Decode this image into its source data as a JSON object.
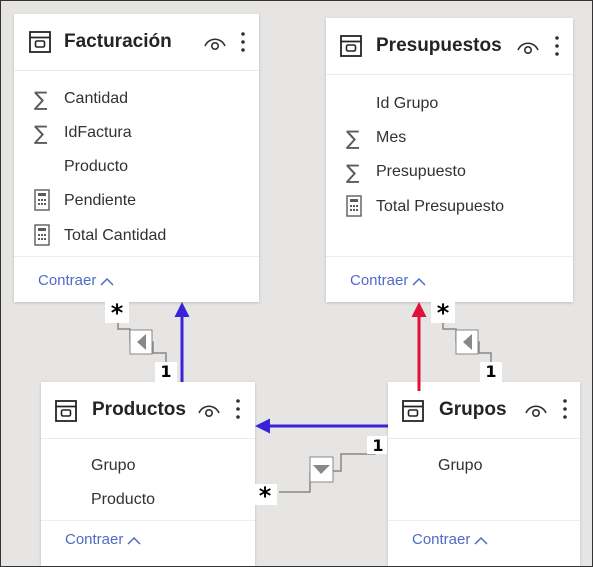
{
  "tables": [
    {
      "title": "Facturación",
      "fields": [
        {
          "icon": "sigma-icon",
          "label": "Cantidad"
        },
        {
          "icon": "sigma-icon",
          "label": "IdFactura"
        },
        {
          "icon": "none",
          "label": "Producto"
        },
        {
          "icon": "calculator-icon",
          "label": "Pendiente"
        },
        {
          "icon": "calculator-icon",
          "label": "Total Cantidad"
        }
      ],
      "collapse_label": "Contraer"
    },
    {
      "title": "Presupuestos",
      "fields": [
        {
          "icon": "none",
          "label": "Id Grupo"
        },
        {
          "icon": "sigma-icon",
          "label": "Mes"
        },
        {
          "icon": "sigma-icon",
          "label": "Presupuesto"
        },
        {
          "icon": "calculator-icon",
          "label": "Total Presupuesto"
        }
      ],
      "collapse_label": "Contraer"
    },
    {
      "title": "Productos",
      "fields": [
        {
          "icon": "none",
          "label": "Grupo"
        },
        {
          "icon": "none",
          "label": "Producto"
        }
      ],
      "collapse_label": "Contraer"
    },
    {
      "title": "Grupos",
      "fields": [
        {
          "icon": "none",
          "label": "Grupo"
        }
      ],
      "collapse_label": "Contraer"
    }
  ],
  "relationships": [
    {
      "from": "Productos",
      "to": "Facturación",
      "from_cardinality": "1",
      "to_cardinality": "*"
    },
    {
      "from": "Grupos",
      "to": "Presupuestos",
      "from_cardinality": "1",
      "to_cardinality": "*"
    },
    {
      "from": "Grupos",
      "to": "Productos",
      "from_cardinality": "1",
      "to_cardinality": "*"
    }
  ],
  "colors": {
    "canvas": "#e6e5e4",
    "card": "#ffffff",
    "title_text": "#252423",
    "field_text": "#323130",
    "collapse_link": "#4f6bc7",
    "connector_line": "#8a8886",
    "arrow_blue": "#3a22d9",
    "arrow_red": "#e0103a"
  }
}
